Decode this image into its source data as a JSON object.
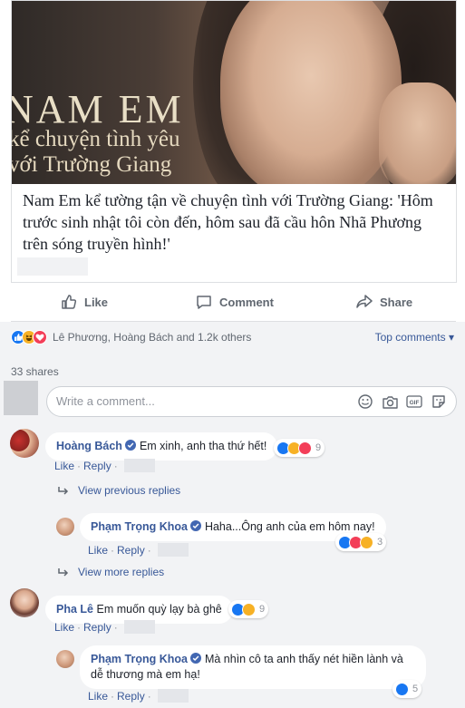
{
  "card": {
    "image_title_line1": "NAM EM",
    "image_title_line2": "kể chuyện tình yêu",
    "image_title_line3": "với Trường Giang",
    "headline": "Nam Em kể tường tận về chuyện tình với Trường Giang: 'Hôm trước sinh nhật tôi còn đến, hôm sau đã cầu hôn Nhã Phương trên sóng truyền hình!'"
  },
  "actions": {
    "like": "Like",
    "comment": "Comment",
    "share": "Share"
  },
  "reactions_summary": {
    "names": "Lê Phương, Hoàng Bách and 1.2k others",
    "sort": "Top comments ▾",
    "shares": "33 shares"
  },
  "composer": {
    "placeholder": "Write a comment..."
  },
  "labels": {
    "like": "Like",
    "reply": "Reply",
    "dot": "·"
  },
  "comments": [
    {
      "author": "Hoàng Bách",
      "text": "Em xinh, anh tha thứ hết!",
      "reaction_count": "9"
    },
    {
      "author": "Phạm Trọng Khoa",
      "text": "Haha...Ông anh của em hôm nay!",
      "reaction_count": "3"
    },
    {
      "author": "Pha Lê",
      "text": "Em muốn quỳ lạy bà ghê",
      "reaction_count": "9"
    },
    {
      "author": "Phạm Trọng Khoa",
      "text_line1": "Mà nhìn cô ta anh thấy nét hiền lành và",
      "text_line2": "dễ thương mà em hạ!",
      "reaction_count": "5"
    }
  ],
  "view_previous_replies": "View previous replies",
  "view_more_replies": "View more replies",
  "colors": {
    "link": "#385898",
    "like_blue": "#1877f2",
    "haha_yellow": "#f7b125",
    "love_red": "#f33e58",
    "panel_bg": "#f2f3f5"
  }
}
